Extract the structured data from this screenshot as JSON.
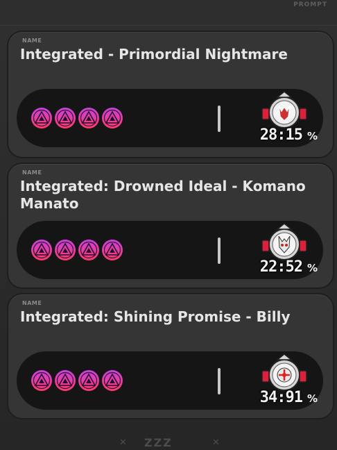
{
  "header": {
    "tag": "PROMPT"
  },
  "cards": [
    {
      "name_label": "NAME",
      "title": "Integrated - Primordial Nightmare",
      "stars": 4,
      "percent_value": "28:15",
      "percent_sign": "%",
      "badge_icon": "wolf-emblem-icon-red"
    },
    {
      "name_label": "NAME",
      "title": "Integrated: Drowned Ideal - Komano Manato",
      "stars": 4,
      "percent_value": "22:52",
      "percent_sign": "%",
      "badge_icon": "wolf-emblem-icon-grey"
    },
    {
      "name_label": "NAME",
      "title": "Integrated: Shining Promise - Billy",
      "stars": 4,
      "percent_value": "34:91",
      "percent_sign": "%",
      "badge_icon": "crosshair-emblem-icon"
    }
  ],
  "footer": {
    "logo": "ZZZ"
  },
  "colors": {
    "pip_top": "#d43fd6",
    "pip_bottom": "#ff3b6b",
    "badge_red": "#e0203a",
    "card_bg": "#353535",
    "bar_bg": "#151515"
  }
}
